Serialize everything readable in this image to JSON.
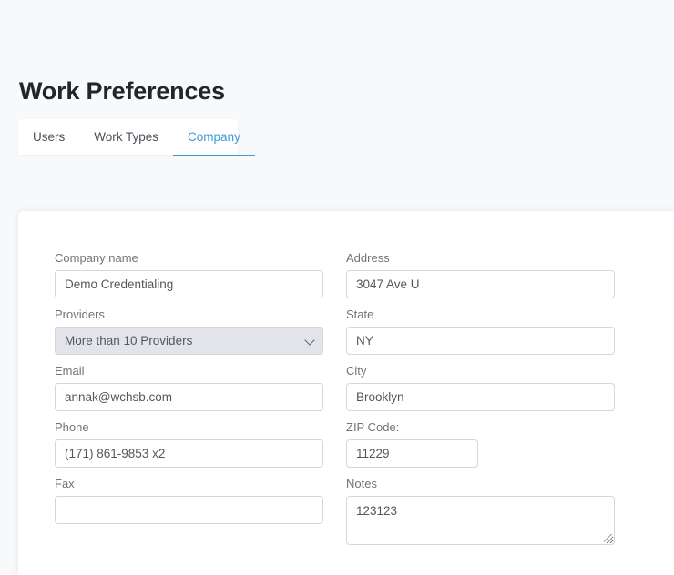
{
  "header": {
    "title": "Work Preferences"
  },
  "tabs": {
    "items": [
      {
        "label": "Users",
        "active": false
      },
      {
        "label": "Work Types",
        "active": false
      },
      {
        "label": "Company",
        "active": true
      }
    ],
    "active_color": "#3d9bd4"
  },
  "form": {
    "left_column": [
      {
        "name": "company-name",
        "label": "Company name",
        "type": "text",
        "value": "Demo Credentialing",
        "placeholder": ""
      },
      {
        "name": "providers",
        "label": "Providers",
        "type": "select",
        "value": "More than 10 Providers",
        "options": [
          "More than 10 Providers"
        ],
        "icon": "chevron-down-icon"
      },
      {
        "name": "email",
        "label": "Email",
        "type": "text",
        "value": "annak@wchsb.com",
        "placeholder": ""
      },
      {
        "name": "phone",
        "label": "Phone",
        "type": "text",
        "value": "(171) 861-9853 x2",
        "placeholder": ""
      },
      {
        "name": "fax",
        "label": "Fax",
        "type": "text",
        "value": "",
        "placeholder": ""
      }
    ],
    "right_column": [
      {
        "name": "address",
        "label": "Address",
        "type": "text",
        "value": "3047 Ave U",
        "placeholder": ""
      },
      {
        "name": "state",
        "label": "State",
        "type": "text",
        "value": "NY",
        "placeholder": ""
      },
      {
        "name": "city",
        "label": "City",
        "type": "text",
        "value": "Brooklyn",
        "placeholder": ""
      },
      {
        "name": "zip-code",
        "label": "ZIP Code:",
        "type": "text",
        "value": "11229",
        "placeholder": "",
        "narrow": true
      },
      {
        "name": "notes",
        "label": "Notes",
        "type": "textarea",
        "value": "123123",
        "placeholder": "",
        "icon": "resize-grip-icon"
      }
    ]
  },
  "colors": {
    "page_background": "#f8f9fb",
    "card_background": "#ffffff",
    "accent": "#3d9bd4",
    "title_text": "#22262b",
    "label_text": "#6f7479",
    "input_text": "#52585e",
    "input_border": "#d3d7dc",
    "select_background": "#e3e4ea"
  }
}
